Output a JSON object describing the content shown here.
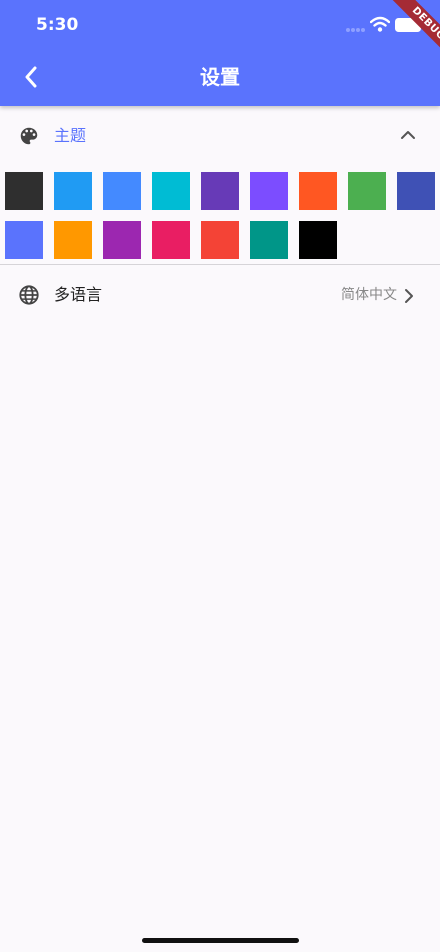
{
  "status_bar": {
    "time": "5:30"
  },
  "debug_banner": {
    "label": "DEBUG"
  },
  "header": {
    "title": "设置"
  },
  "theme_section": {
    "label": "主题",
    "expanded": true,
    "accent_color": "#5a73fd",
    "colors": [
      "#2f2f2f",
      "#209bf3",
      "#448aff",
      "#00bcd4",
      "#673ab7",
      "#7c4dff",
      "#ff5722",
      "#4caf50",
      "#3f51b5",
      "#5a73fd",
      "#ff9800",
      "#9c27b0",
      "#e91e63",
      "#f44336",
      "#009688",
      "#000000"
    ]
  },
  "language_row": {
    "label": "多语言",
    "value": "简体中文"
  }
}
